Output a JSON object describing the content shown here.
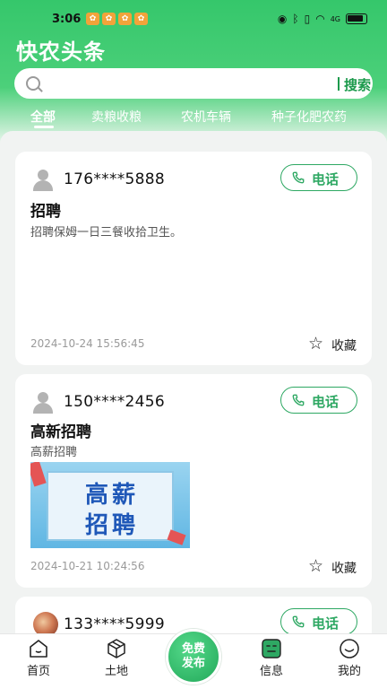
{
  "status_bar": {
    "time": "3:06",
    "network": "4G"
  },
  "app": {
    "title": "快农头条"
  },
  "search": {
    "button_label": "搜索"
  },
  "tabs": [
    {
      "label": "全部",
      "active": true
    },
    {
      "label": "卖粮收粮",
      "active": false
    },
    {
      "label": "农机车辆",
      "active": false
    },
    {
      "label": "种子化肥农药",
      "active": false
    }
  ],
  "posts": [
    {
      "phone": "176****5888",
      "call_label": "电话",
      "title": "招聘",
      "description": "招聘保姆一日三餐收拾卫生。",
      "date": "2024-10-24 15:56:45",
      "favorite_label": "收藏"
    },
    {
      "phone": "150****2456",
      "call_label": "电话",
      "title": "高新招聘",
      "description": "高薪招聘",
      "image_text_line1": "高薪",
      "image_text_line2": "招聘",
      "date": "2024-10-21 10:24:56",
      "favorite_label": "收藏"
    },
    {
      "phone": "133****5999",
      "call_label": "电话"
    }
  ],
  "bottom_nav": {
    "home": "首页",
    "land": "土地",
    "publish_line1": "免费",
    "publish_line2": "发布",
    "messages": "信息",
    "mine": "我的"
  },
  "colors": {
    "brand_green": "#35c76b",
    "accent_green": "#2ea863"
  }
}
